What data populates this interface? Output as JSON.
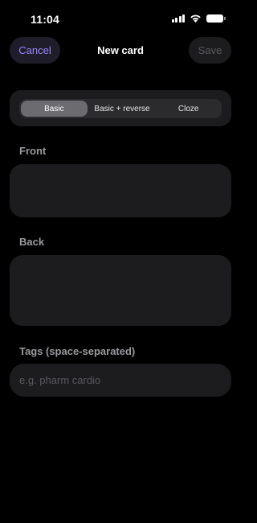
{
  "status_bar": {
    "time": "11:04",
    "icons": [
      "signal-icon",
      "wifi-icon",
      "battery-icon"
    ]
  },
  "nav": {
    "cancel_label": "Cancel",
    "title": "New card",
    "save_label": "Save",
    "accent_color": "#9b86ff"
  },
  "card_type": {
    "options": [
      "Basic",
      "Basic + reverse",
      "Cloze"
    ],
    "selected": "Basic"
  },
  "front": {
    "label": "Front",
    "value": ""
  },
  "back": {
    "label": "Back",
    "value": ""
  },
  "tags": {
    "label": "Tags (space-separated)",
    "placeholder": "e.g. pharm cardio",
    "value": ""
  }
}
